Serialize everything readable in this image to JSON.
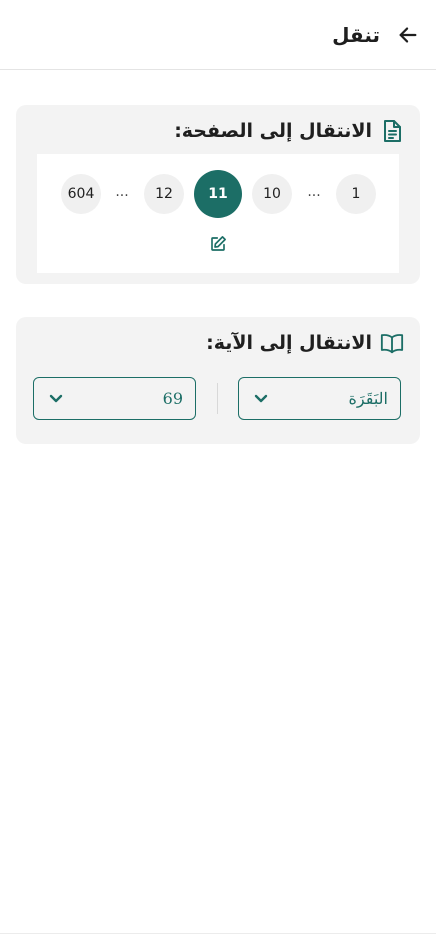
{
  "header": {
    "title": "تنقل",
    "back_icon": "arrow-left-icon"
  },
  "page_nav": {
    "label": "الانتقال إلى الصفحة:",
    "icon": "document-icon",
    "pages": [
      {
        "label": "1",
        "active": false
      },
      {
        "label": "...",
        "ellipsis": true
      },
      {
        "label": "10",
        "active": false
      },
      {
        "label": "11",
        "active": true
      },
      {
        "label": "12",
        "active": false
      },
      {
        "label": "...",
        "ellipsis": true
      },
      {
        "label": "604",
        "active": false
      }
    ],
    "edit_icon": "edit-icon"
  },
  "ayah_nav": {
    "label": "الانتقال إلى الآية:",
    "icon": "open-book-icon",
    "surah_value": "البَقَرَة",
    "ayah_value": "69"
  },
  "colors": {
    "accent": "#1c6e66",
    "card_bg": "#f3f3f3",
    "chip_bg": "#f0f0f0"
  }
}
